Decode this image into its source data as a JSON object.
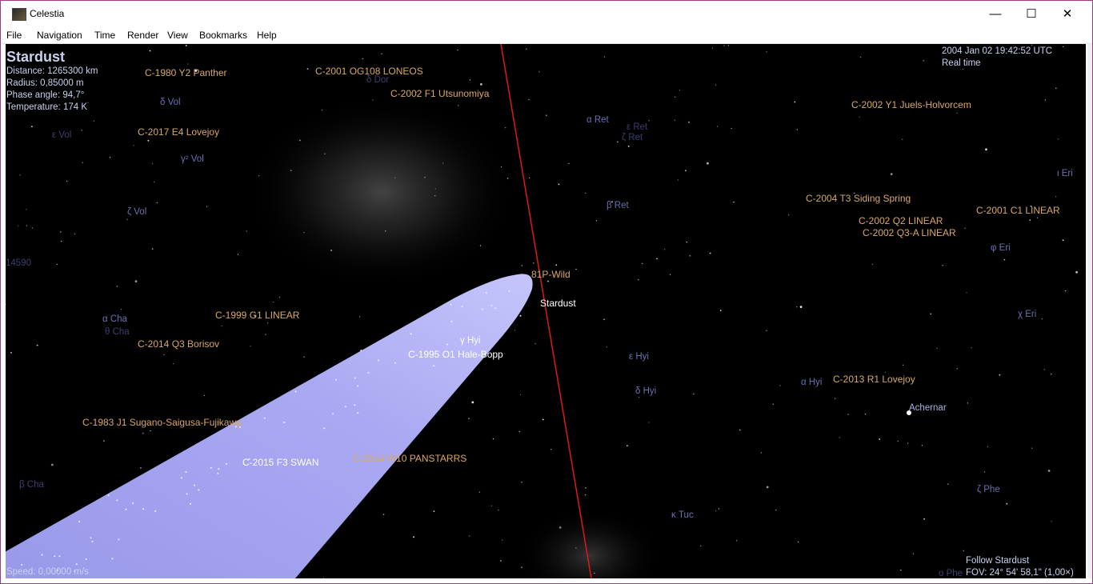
{
  "window": {
    "title": "Celestia",
    "minimize_glyph": "—",
    "maximize_glyph": "☐",
    "close_glyph": "✕",
    "icon": "celestia-app-icon"
  },
  "menu": [
    "File",
    "Navigation",
    "Time",
    "Render",
    "View",
    "Bookmarks",
    "Help"
  ],
  "hud": {
    "target": "Stardust",
    "distance": "Distance: 1265300 km",
    "radius": "Radius: 0,85000 m",
    "phase": "Phase angle: 94,7°",
    "temperature": "Temperature: 174 K",
    "datetime": "2004 Jan 02 19:42:52 UTC",
    "time_mode": "Real time",
    "speed": "Speed: 0,00000 m/s",
    "follow": "Follow Stardust",
    "fov": "FOV: 24° 54' 58,1\" (1,00×)"
  },
  "comet_labels": [
    "C-1980 Y2 Panther",
    "C-2001 OG108 LONEOS",
    "C-2002 F1 Utsunomiya",
    "C-2017 E4 Lovejoy",
    "C-2002 Y1 Juels-Holvorcem",
    "C-2004 T3 Siding Spring",
    "C-2002 Q2 LINEAR",
    "C-2001 C1 LINEAR",
    "C-2002 Q3-A LINEAR",
    "81P-Wild",
    "C-1999 G1 LINEAR",
    "C-2014 Q3 Borisov",
    "C-2013 R1 Lovejoy",
    "C-1983 J1 Sugano-Saigusa-Fujikawa",
    "C-2014 W10 PANSTARRS"
  ],
  "white_labels": [
    "Stardust",
    "C-1995 O1 Hale-Bopp",
    "C-2015 F3 SWAN",
    "Achernar",
    "γ Hyi"
  ],
  "star_labels": [
    "δ Vol",
    "γ² Vol",
    "ζ Vol",
    "ε Vol",
    "α Ret",
    "β Ret",
    "ι Eri",
    "φ Eri",
    "χ Eri",
    "ε Hyi",
    "δ Hyi",
    "α Hyi",
    "ζ Phe",
    "κ Tuc",
    "α Cha",
    "θ Cha",
    "β Cha",
    "ε Ret",
    "ζ Ret",
    "δ Dor",
    "ο Phe",
    "14590"
  ],
  "colors": {
    "comet_label": "#d9a865",
    "star_label": "#6b6fb0",
    "hud_text": "#c9d2ee",
    "orbit_line": "#e01818",
    "comet_tail": "#a8a8f2",
    "sky": "#000000",
    "window_border": "#9b3b82"
  }
}
